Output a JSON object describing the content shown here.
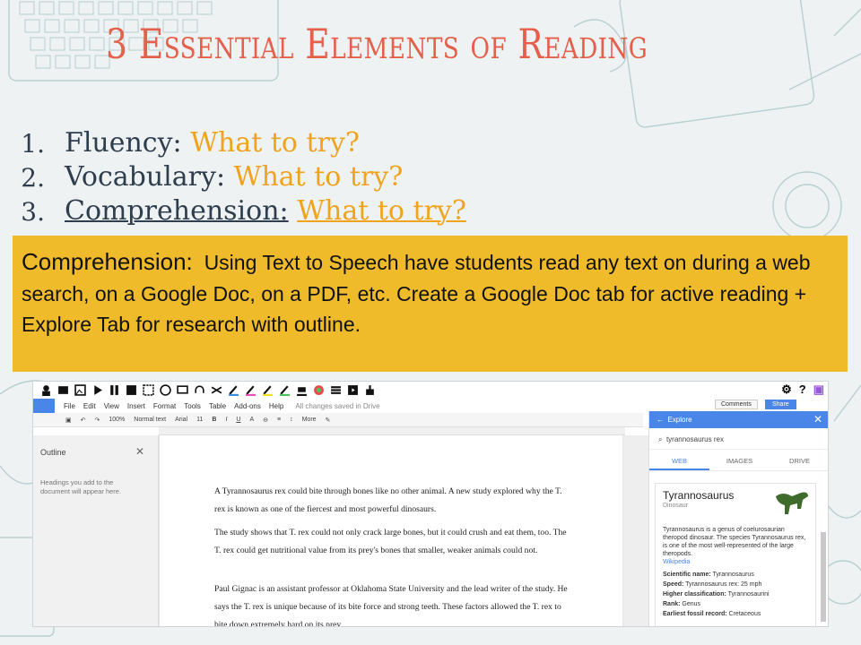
{
  "slide": {
    "title": "3 Essential Elements of Reading",
    "elements": [
      {
        "num": "1.",
        "name": "Fluency:",
        "try": "What to try?"
      },
      {
        "num": "2.",
        "name": "Vocabulary:",
        "try": "What to try?"
      },
      {
        "num": "3.",
        "name": "Comprehension:",
        "try": "What to try?"
      }
    ],
    "callout": {
      "lead": "Comprehension:",
      "text": "Using Text to Speech have students read any text on during a web search, on a Google Doc, on a PDF, etc. Create a Google Doc tab for active reading + Explore Tab for research with outline."
    }
  },
  "doc": {
    "menu": [
      "File",
      "Edit",
      "View",
      "Insert",
      "Format",
      "Tools",
      "Table",
      "Add-ons",
      "Help"
    ],
    "saved_status": "All changes saved in Drive",
    "comments_label": "Comments",
    "share_label": "Share",
    "toolbar": {
      "zoom": "100%",
      "style": "Normal text",
      "font": "Arial",
      "size": "11",
      "more": "More"
    },
    "outline": {
      "title": "Outline",
      "hint": "Headings you add to the document will appear here."
    },
    "paragraphs": [
      "A Tyrannosaurus rex could bite through bones like no other animal. A new study explored why the T. rex is known as one of the fiercest and most powerful dinosaurs.",
      "The study shows that T. rex could not only crack large bones, but it could crush and eat them, too. The T. rex could get nutritional value from its prey's bones that smaller, weaker animals could not.",
      "Paul Gignac is an assistant professor at Oklahoma State University and the lead writer of the study. He says the T. rex is unique because of its bite force and strong teeth. These factors allowed the T. rex to bite down extremely hard on its prey."
    ],
    "explore": {
      "title": "Explore",
      "query": "tyrannosaurus rex",
      "tabs": [
        "WEB",
        "IMAGES",
        "DRIVE"
      ],
      "card_title": "Tyrannosaurus",
      "card_subtitle": "Dinosaur",
      "card_desc": "Tyrannosaurus is a genus of coelurosaurian theropod dinosaur. The species Tyrannosaurus rex, is one of the most well-represented of the large theropods.",
      "card_source": "Wikipedia",
      "facts": [
        {
          "k": "Scientific name:",
          "v": "Tyrannosaurus"
        },
        {
          "k": "Speed:",
          "v": "Tyrannosaurus rex: 25 mph"
        },
        {
          "k": "Higher classification:",
          "v": "Tyrannosaurini"
        },
        {
          "k": "Rank:",
          "v": "Genus"
        },
        {
          "k": "Earliest fossil record:",
          "v": "Cretaceous"
        }
      ]
    }
  },
  "colors": {
    "title": "#e4604a",
    "try": "#f0a31c",
    "callout_bg": "#f0bb2a",
    "google_blue": "#4a86e8"
  }
}
